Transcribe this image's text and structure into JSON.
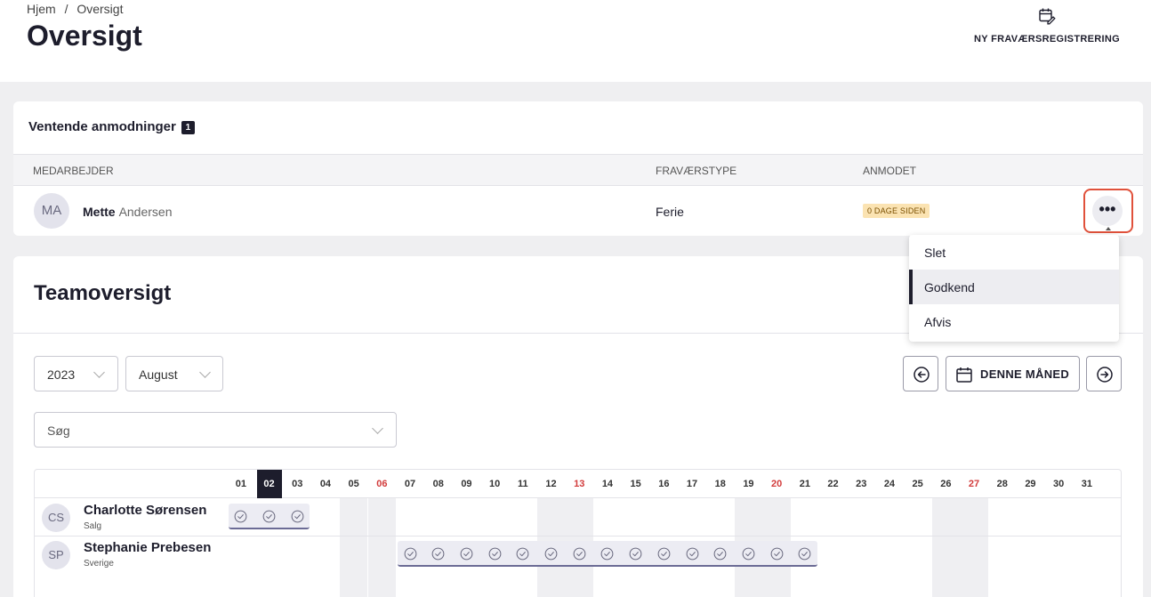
{
  "breadcrumb": {
    "home": "Hjem",
    "separator": "/",
    "current": "Oversigt"
  },
  "page_title": "Oversigt",
  "new_absence": {
    "label": "NY FRAVÆRSREGISTRERING",
    "icon": "calendar-edit-icon"
  },
  "pending": {
    "title": "Ventende anmodninger",
    "count": "1",
    "columns": {
      "employee": "MEDARBEJDER",
      "type": "FRAVÆRSTYPE",
      "requested": "ANMODET"
    },
    "rows": [
      {
        "initials": "MA",
        "first_name": "Mette",
        "last_name": "Andersen",
        "type": "Ferie",
        "age": "0 DAGE SIDEN",
        "more": "•••"
      }
    ]
  },
  "menu": {
    "items": [
      "Slet",
      "Godkend",
      "Afvis"
    ],
    "active_index": 1
  },
  "team": {
    "title": "Teamoversigt",
    "year": "2023",
    "month": "August",
    "search_placeholder": "Søg",
    "this_month": "DENNE MÅNED"
  },
  "calendar": {
    "today": "02",
    "days": [
      "01",
      "02",
      "03",
      "04",
      "05",
      "06",
      "07",
      "08",
      "09",
      "10",
      "11",
      "12",
      "13",
      "14",
      "15",
      "16",
      "17",
      "18",
      "19",
      "20",
      "21",
      "22",
      "23",
      "24",
      "25",
      "26",
      "27",
      "28",
      "29",
      "30",
      "31"
    ],
    "weekend_red": [
      "06",
      "13",
      "20",
      "27"
    ],
    "weekend_shaded": [
      "05",
      "06",
      "12",
      "13",
      "19",
      "20",
      "26",
      "27"
    ],
    "employees": [
      {
        "initials": "CS",
        "name": "Charlotte Sørensen",
        "dept": "Salg",
        "absence_days": [
          "01",
          "02",
          "03"
        ]
      },
      {
        "initials": "SP",
        "name": "Stephanie Prebesen",
        "dept": "Sverige",
        "absence_days": [
          "07",
          "08",
          "09",
          "10",
          "11",
          "12",
          "13",
          "14",
          "15",
          "16",
          "17",
          "18",
          "19",
          "20",
          "21"
        ]
      }
    ]
  }
}
